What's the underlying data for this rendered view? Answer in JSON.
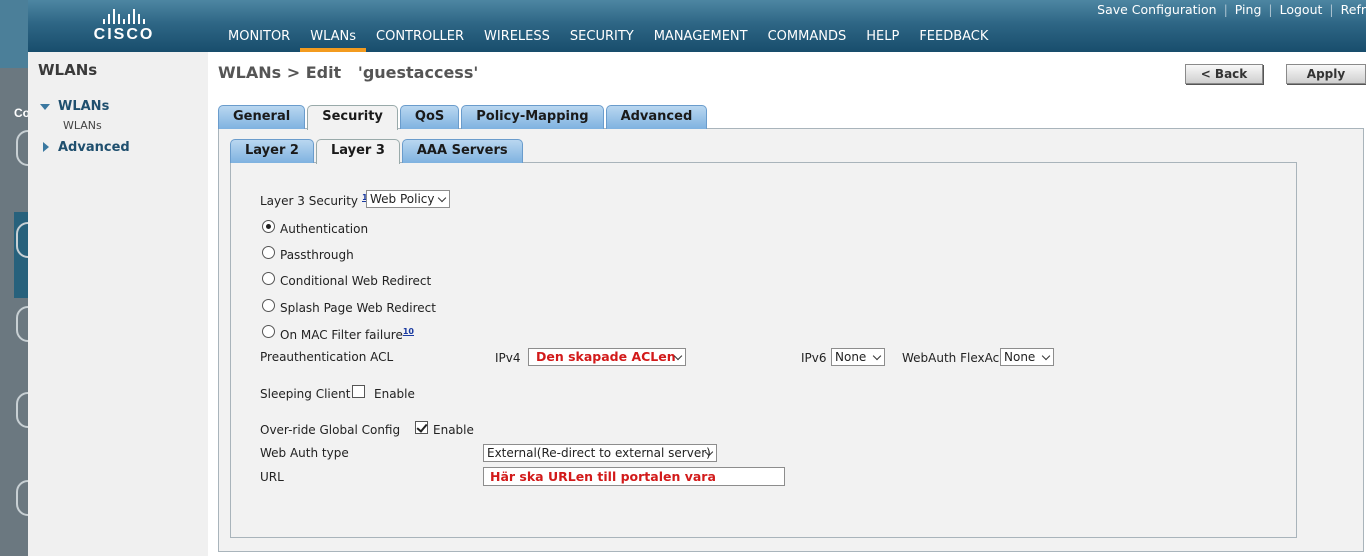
{
  "header": {
    "logo_text": "CISCO",
    "nav": [
      {
        "label": "MONITOR",
        "active": false
      },
      {
        "label": "WLANs",
        "active": true
      },
      {
        "label": "CONTROLLER",
        "active": false
      },
      {
        "label": "WIRELESS",
        "active": false
      },
      {
        "label": "SECURITY",
        "active": false
      },
      {
        "label": "MANAGEMENT",
        "active": false
      },
      {
        "label": "COMMANDS",
        "active": false
      },
      {
        "label": "HELP",
        "active": false
      },
      {
        "label": "FEEDBACK",
        "active": false
      }
    ],
    "utility": {
      "save": "Save Configuration",
      "ping": "Ping",
      "logout": "Logout",
      "refresh": "Refr",
      "separator": "|"
    }
  },
  "background_window": {
    "label": "Co"
  },
  "sidebar": {
    "title": "WLANs",
    "group_wlans": "WLANs",
    "sub_wlans": "WLANs",
    "group_advanced": "Advanced"
  },
  "page": {
    "title": "WLANs > Edit   'guestaccess'",
    "back_label": "< Back",
    "apply_label": "Apply"
  },
  "tabs_primary": [
    "General",
    "Security",
    "QoS",
    "Policy-Mapping",
    "Advanced"
  ],
  "tabs_primary_active": "Security",
  "tabs_secondary": [
    "Layer 2",
    "Layer 3",
    "AAA Servers"
  ],
  "tabs_secondary_active": "Layer 3",
  "form": {
    "l3_security_label": "Layer 3 Security",
    "l3_security_footnote": "1",
    "l3_security_value": "Web Policy",
    "radio_authentication": "Authentication",
    "radio_passthrough": "Passthrough",
    "radio_conditional": "Conditional Web Redirect",
    "radio_splash": "Splash Page Web Redirect",
    "radio_mac_filter": "On MAC Filter failure",
    "radio_mac_filter_footnote": "10",
    "preauth_label": "Preauthentication ACL",
    "ipv4_label": "IPv4",
    "ipv4_value": "Den skapade ACLen",
    "ipv6_label": "IPv6",
    "ipv6_value": "None",
    "flexacl_label": "WebAuth FlexAcl",
    "flexacl_value": "None",
    "sleeping_label": "Sleeping Client",
    "sleeping_enable": "Enable",
    "sleeping_checked": false,
    "override_label": "Over-ride Global Config",
    "override_enable": "Enable",
    "override_checked": true,
    "webauth_type_label": "Web Auth type",
    "webauth_type_value": "External(Re-direct to external server)",
    "url_label": "URL",
    "url_value": "Här ska URLen till portalen vara"
  },
  "colors": {
    "header_top": "#4d86a2",
    "header_bottom": "#184d6c",
    "active_nav_underline": "#f39b1f",
    "tab_blue": "#7fb2e0",
    "annotation_red": "#d21a1a"
  }
}
